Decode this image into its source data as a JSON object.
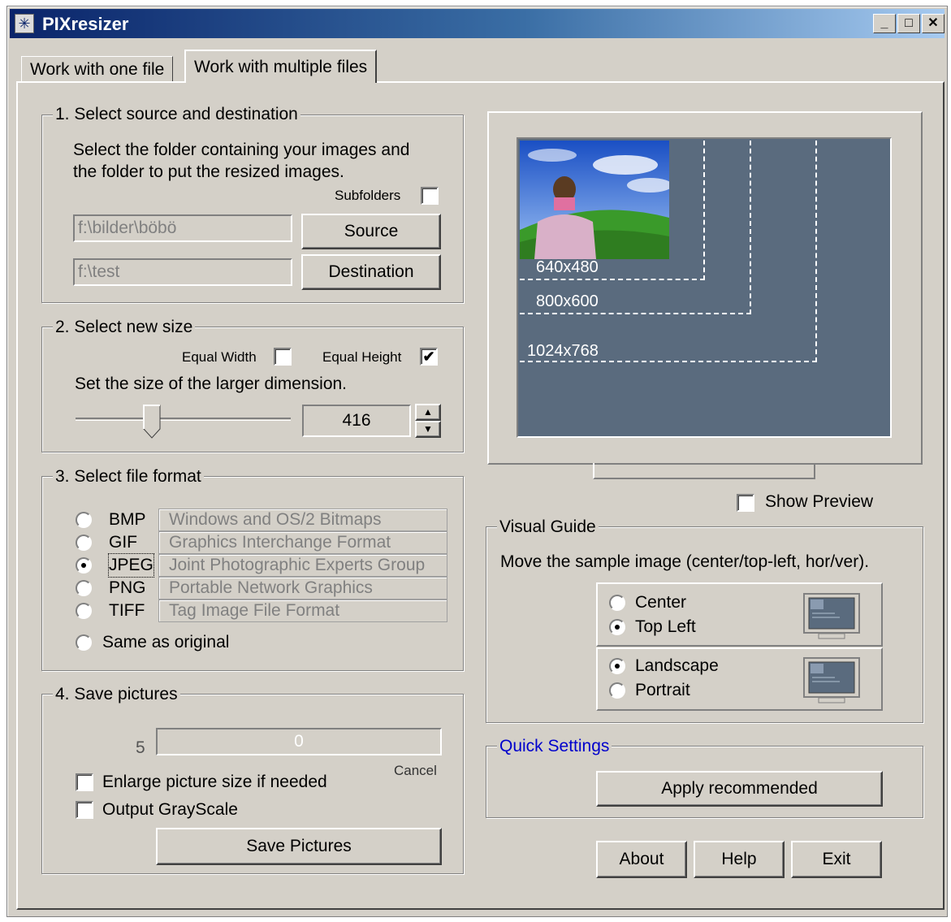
{
  "window": {
    "title": "PIXresizer"
  },
  "tabs": [
    {
      "label": "Work with one file"
    },
    {
      "label": "Work with multiple files"
    }
  ],
  "source_dest": {
    "group_label": "1. Select source and destination",
    "description_line1": "Select the folder containing your images and",
    "description_line2": "the folder to put the resized images.",
    "subfolders_label": "Subfolders",
    "subfolders_checked": false,
    "source_path": "f:\\bilder\\böbö",
    "source_button": "Source",
    "dest_path": "f:\\test",
    "dest_button": "Destination"
  },
  "new_size": {
    "group_label": "2. Select new size",
    "equal_width_label": "Equal Width",
    "equal_width_checked": false,
    "equal_height_label": "Equal Height",
    "equal_height_checked": true,
    "instruction": "Set the size of the larger dimension.",
    "value": "416"
  },
  "file_format": {
    "group_label": "3. Select file format",
    "options": [
      {
        "name": "BMP",
        "description": "Windows and OS/2 Bitmaps",
        "selected": false
      },
      {
        "name": "GIF",
        "description": "Graphics Interchange Format",
        "selected": false
      },
      {
        "name": "JPEG",
        "description": "Joint Photographic Experts Group",
        "selected": true
      },
      {
        "name": "PNG",
        "description": "Portable Network Graphics",
        "selected": false
      },
      {
        "name": "TIFF",
        "description": "Tag Image File Format",
        "selected": false
      }
    ],
    "same_as_original": "Same as original"
  },
  "save": {
    "group_label": "4. Save pictures",
    "count": "5",
    "progress_text": "0",
    "progress": 0,
    "cancel_label": "Cancel",
    "enlarge_label": "Enlarge picture size if needed",
    "enlarge_checked": false,
    "grayscale_label": "Output GrayScale",
    "grayscale_checked": false,
    "save_button": "Save Pictures"
  },
  "preview": {
    "size_labels": [
      "640x480",
      "800x600",
      "1024x768"
    ],
    "show_preview_label": "Show Preview",
    "show_preview_checked": false
  },
  "visual_guide": {
    "group_label": "Visual Guide",
    "instruction": "Move the sample image (center/top-left, hor/ver).",
    "position_options": [
      {
        "label": "Center",
        "selected": false
      },
      {
        "label": "Top Left",
        "selected": true
      }
    ],
    "orientation_options": [
      {
        "label": "Landscape",
        "selected": true
      },
      {
        "label": "Portrait",
        "selected": false
      }
    ]
  },
  "quick_settings": {
    "group_label": "Quick Settings",
    "apply_button": "Apply recommended"
  },
  "footer": {
    "about_button": "About",
    "help_button": "Help",
    "exit_button": "Exit"
  },
  "colors": {
    "face": "#d4d0c8",
    "title_start": "#0a246a",
    "title_end": "#a6caf0",
    "preview_screen": "#5a6b7e",
    "quick_settings_label": "#0000cc"
  }
}
